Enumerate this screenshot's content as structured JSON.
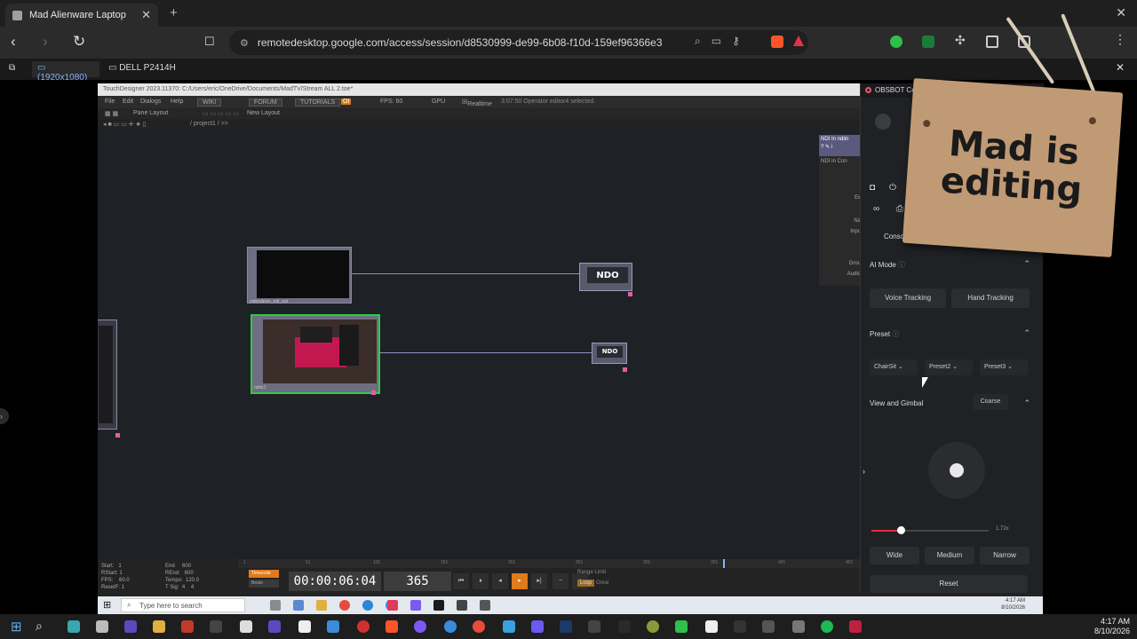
{
  "browser": {
    "tab_title": "Mad Alienware Laptop",
    "tab_close": "✕",
    "new_tab": "+",
    "window_close": "✕",
    "back": "‹",
    "forward": "›",
    "reload": "↻",
    "bookmark": "☐",
    "url": "remotedesktop.google.com/access/session/d8530999-de99-6b08-f10d-159ef96366e3"
  },
  "remote_bar": {
    "tab_resolution": "(1920x1080)",
    "tab_monitor": "DELL P2414H",
    "close": "✕"
  },
  "touchdesigner": {
    "title": "TouchDesigner 2023.11370: C:/Users/eric/OneDrive/Documents/MadTV/Stream ALL 2.toe*",
    "menu": [
      "File",
      "Edit",
      "Dialogs",
      "Help"
    ],
    "buttons": [
      "WIKI",
      "FORUM",
      "TUTORIALS"
    ],
    "fps_label": "FPS: 60",
    "gpu_label": "GPU",
    "realtime_label": "Realtime",
    "status": "3:07:50 Operator editor4 selected.",
    "pane_layout": "Pane Layout",
    "new_layout": "New Layout",
    "path": "/ project1 / >>",
    "ndo_label_1": "NDO",
    "ndo_label_2": "NDO",
    "node1_name": "videodevin_ndi_out",
    "node2_name": "ndiin1",
    "stats_col1": "Start:   1\nRStart: 1\nFPS:    60.0\nResetF: 1",
    "stats_col2": "End     600\nREnd:   600\nTempo:  120.0\nT Sig:  4    4",
    "timecode_label": "Timecode",
    "beats_label": "Beats",
    "timecode": "00:00:06:04",
    "frame": "365",
    "range_limit": "Range Limit",
    "loop": "Loop",
    "once": "Once",
    "timeline_ticks": [
      "1",
      "51",
      "101",
      "151",
      "201",
      "251",
      "301",
      "351",
      "401",
      "451"
    ]
  },
  "ndi_panel": {
    "header1": "NDI In  ndiin",
    "header2": "NDI In  Con",
    "labels": [
      "Ex",
      "Na",
      "Inpu",
      "Grou",
      "Audio"
    ]
  },
  "obsbot": {
    "title": "OBSBOT Center",
    "console_tab": "Console",
    "ai_mode": "AI Mode",
    "voice_tracking": "Voice Tracking",
    "hand_tracking": "Hand Tracking",
    "preset": "Preset",
    "presets": [
      "ChairSit",
      "Preset2",
      "Preset3"
    ],
    "view_gimbal": "View and Gimbal",
    "coarse": "Coarse",
    "zoom_value": "1.72x",
    "zoom_fraction": 0.25,
    "fov_options": [
      "Wide",
      "Medium",
      "Narrow"
    ],
    "reset": "Reset"
  },
  "sign": {
    "line1": "Mad is",
    "line2": "editing"
  },
  "win_taskbar": {
    "search_placeholder": "Type here to search",
    "time": "4:17 AM",
    "date": "8/10/2026"
  },
  "host_taskbar": {
    "time": "4:17 AM",
    "date": "8/10/2026"
  }
}
